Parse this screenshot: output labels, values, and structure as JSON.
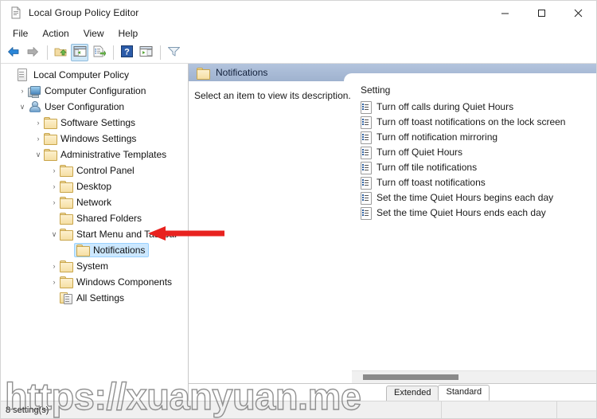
{
  "window": {
    "title": "Local Group Policy Editor",
    "title_icon": "policy-document-icon",
    "minimize_label": "–",
    "maximize_label": "☐",
    "close_label": "✕"
  },
  "menubar": {
    "items": [
      {
        "label": "File"
      },
      {
        "label": "Action"
      },
      {
        "label": "View"
      },
      {
        "label": "Help"
      }
    ]
  },
  "toolbar": {
    "buttons": [
      {
        "name": "back-button",
        "icon": "back-arrow-icon"
      },
      {
        "name": "forward-button",
        "icon": "forward-arrow-icon"
      },
      {
        "name": "up-one-level-button",
        "icon": "folder-up-icon"
      },
      {
        "name": "show-hide-console-tree-button",
        "icon": "console-tree-icon",
        "active": true
      },
      {
        "name": "export-list-button",
        "icon": "export-list-icon"
      },
      {
        "name": "help-button",
        "icon": "question-mark-icon"
      },
      {
        "name": "show-hide-action-pane-button",
        "icon": "action-pane-icon"
      },
      {
        "name": "filter-button",
        "icon": "filter-funnel-icon"
      }
    ]
  },
  "tree": {
    "items": [
      {
        "label": "Local Computer Policy",
        "indent": 0,
        "twisty": "",
        "icon": "policy-document-icon",
        "selected": false
      },
      {
        "label": "Computer Configuration",
        "indent": 1,
        "twisty": "›",
        "icon": "computer-icon",
        "selected": false
      },
      {
        "label": "User Configuration",
        "indent": 1,
        "twisty": "∨",
        "icon": "user-icon",
        "selected": false
      },
      {
        "label": "Software Settings",
        "indent": 2,
        "twisty": "›",
        "icon": "folder-icon",
        "selected": false
      },
      {
        "label": "Windows Settings",
        "indent": 2,
        "twisty": "›",
        "icon": "folder-icon",
        "selected": false
      },
      {
        "label": "Administrative Templates",
        "indent": 2,
        "twisty": "∨",
        "icon": "folder-icon",
        "selected": false
      },
      {
        "label": "Control Panel",
        "indent": 3,
        "twisty": "›",
        "icon": "folder-icon",
        "selected": false
      },
      {
        "label": "Desktop",
        "indent": 3,
        "twisty": "›",
        "icon": "folder-icon",
        "selected": false
      },
      {
        "label": "Network",
        "indent": 3,
        "twisty": "›",
        "icon": "folder-icon",
        "selected": false
      },
      {
        "label": "Shared Folders",
        "indent": 3,
        "twisty": "",
        "icon": "folder-icon",
        "selected": false
      },
      {
        "label": "Start Menu and Taskbar",
        "indent": 3,
        "twisty": "∨",
        "icon": "folder-icon",
        "selected": false
      },
      {
        "label": "Notifications",
        "indent": 4,
        "twisty": "",
        "icon": "folder-icon",
        "selected": true
      },
      {
        "label": "System",
        "indent": 3,
        "twisty": "›",
        "icon": "folder-icon",
        "selected": false
      },
      {
        "label": "Windows Components",
        "indent": 3,
        "twisty": "›",
        "icon": "folder-icon",
        "selected": false
      },
      {
        "label": "All Settings",
        "indent": 3,
        "twisty": "",
        "icon": "all-settings-icon",
        "selected": false
      }
    ]
  },
  "pane": {
    "header_title": "Notifications",
    "header_icon": "folder-icon",
    "description": "Select an item to view its description.",
    "list_column_header": "Setting",
    "settings": [
      {
        "label": "Turn off calls during Quiet Hours"
      },
      {
        "label": "Turn off toast notifications on the lock screen"
      },
      {
        "label": "Turn off notification mirroring"
      },
      {
        "label": "Turn off Quiet Hours"
      },
      {
        "label": "Turn off tile notifications"
      },
      {
        "label": "Turn off toast notifications"
      },
      {
        "label": "Set the time Quiet Hours begins each day"
      },
      {
        "label": "Set the time Quiet Hours ends each day"
      }
    ]
  },
  "tabs": [
    {
      "label": "Extended",
      "active": false
    },
    {
      "label": "Standard",
      "active": true
    }
  ],
  "statusbar": {
    "text": "8 setting(s)"
  },
  "annotation": {
    "arrow": "red-left-arrow",
    "arrow_color": "#e8221f"
  },
  "watermark": {
    "text": "https://xuanyuan.me"
  }
}
